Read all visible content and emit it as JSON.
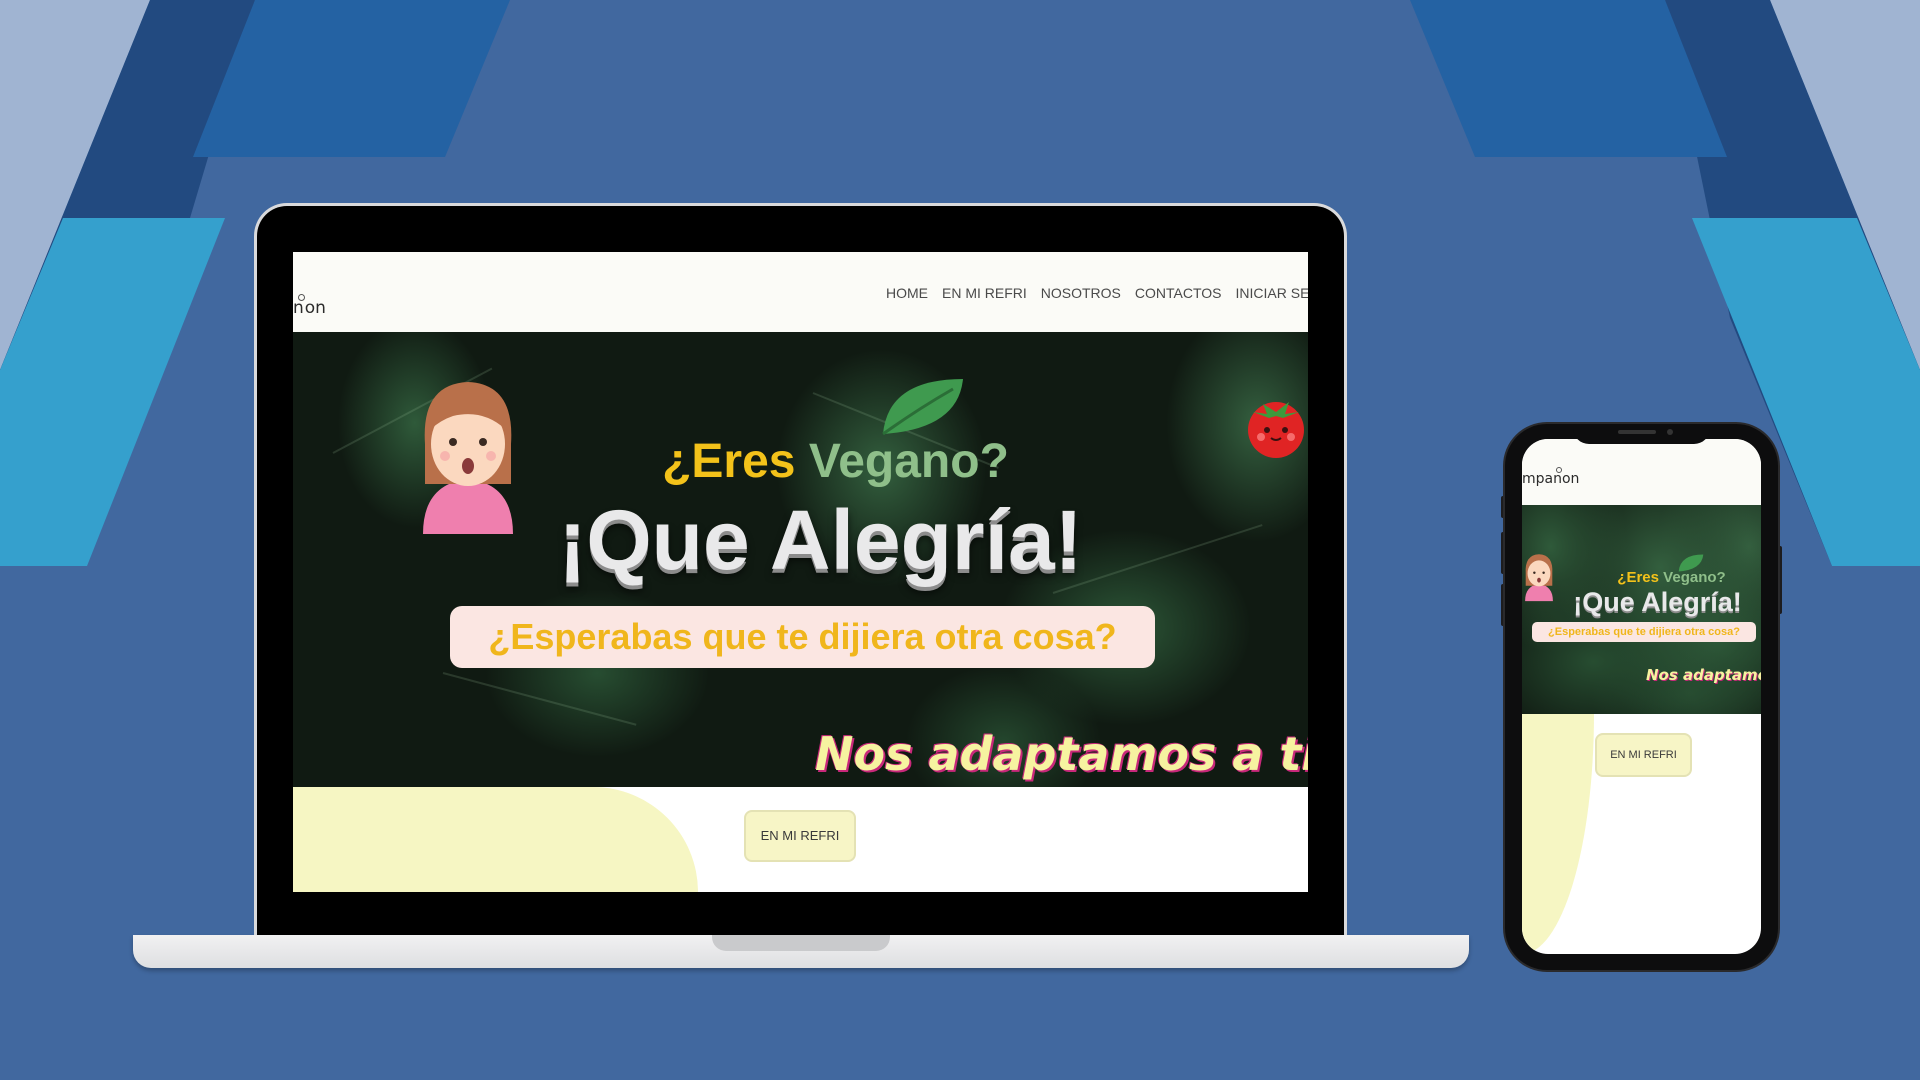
{
  "background": {
    "color": "#41689f",
    "accents": [
      "#a0b4d2",
      "#224a80",
      "#2462a3",
      "#35a0cd"
    ]
  },
  "laptop": {
    "logo": "n",
    "logo_tail": "on",
    "nav": [
      "HOME",
      "EN MI REFRI",
      "NOSOTROS",
      "CONTACTOS",
      "INICIAR SES"
    ],
    "hero": {
      "question_eres": "¿Eres",
      "question_vegano": "Vegano?",
      "title": "¡Que Alegría!",
      "subtitle": "¿Esperabas que te dijiera otra cosa?",
      "tagline": "Nos adaptamos a ti"
    },
    "cta_label": "EN MI REFRI",
    "icons": [
      "girl-avatar-icon",
      "leaf-icon",
      "tomato-icon"
    ]
  },
  "phone": {
    "logo": "mpan",
    "logo_tail": "on",
    "hero": {
      "question_eres": "¿Eres",
      "question_vegano": "Vegano?",
      "title": "¡Que Alegría!",
      "subtitle": "¿Esperabas que te dijiera otra cosa?",
      "tagline": "Nos adaptamo"
    },
    "cta_label": "EN MI REFRI"
  },
  "colors": {
    "hero_yellow": "#f3c21a",
    "hero_green": "#8fbf8a",
    "tagline_pink": "#c8287a",
    "button_bg": "#f7f5c6",
    "blob": "#f6f6c3"
  }
}
